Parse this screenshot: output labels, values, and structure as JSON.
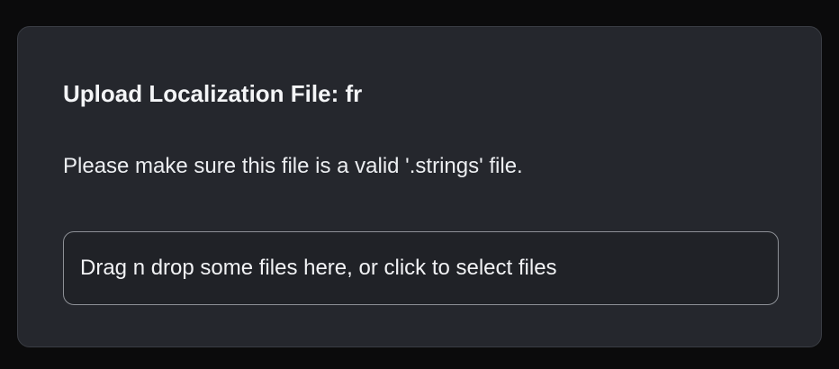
{
  "dialog": {
    "title": "Upload Localization File: fr",
    "description": "Please make sure this file is a valid '.strings' file.",
    "dropzone_label": "Drag n drop some files here, or click to select files"
  },
  "colors": {
    "page_background": "#0b0b0c",
    "card_background": "#25272d",
    "card_border": "#3a3d44",
    "dropzone_border": "#8d9096",
    "text": "#f4f5f7"
  }
}
